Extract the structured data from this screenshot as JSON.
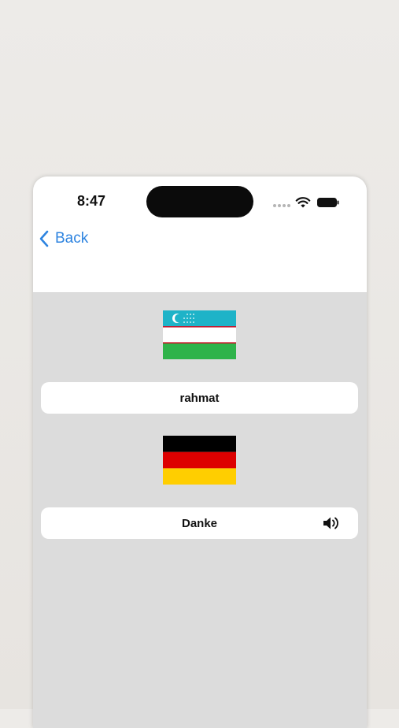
{
  "status_bar": {
    "time": "8:47",
    "icons": [
      "signal-dots-icon",
      "wifi-icon",
      "battery-icon"
    ]
  },
  "nav": {
    "back_label": "Back",
    "back_icon": "chevron-left-icon",
    "accent_color": "#2e84e0"
  },
  "source": {
    "flag": "uzbekistan-flag",
    "word": "rahmat"
  },
  "target": {
    "flag": "germany-flag",
    "word": "Danke",
    "audio_icon": "speaker-icon"
  },
  "colors": {
    "background": "#dcdcdc",
    "card": "#ffffff"
  }
}
